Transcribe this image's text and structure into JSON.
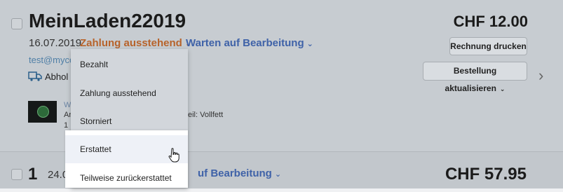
{
  "order1": {
    "title": "MeinLaden22019",
    "date": "16.07.2019",
    "payment_status": "Zahlung ausstehend",
    "fulfillment_status": "Warten auf Bearbeitung",
    "email": "test@myco",
    "pickup": "Abhol",
    "price": "CHF 12.00",
    "print_button": "Rechnung drucken",
    "update_button": "Bestellung aktualisieren",
    "product": {
      "name_link": "W",
      "variant_prefix": "Ar",
      "variant_suffix": "eil: Vollfett",
      "qty": "1"
    }
  },
  "order2": {
    "number": "1",
    "date": "24.06",
    "fulfillment_status": "uf Bearbeitung",
    "price": "CHF 57.95"
  },
  "payment_dropdown": {
    "items": [
      "Bezahlt",
      "Zahlung ausstehend",
      "Storniert",
      "Erstattet",
      "Teilweise zurückerstattet"
    ],
    "hovered_item": "Erstattet"
  },
  "colors": {
    "payment_pending": "#b7632b",
    "link_blue": "#3f62a8",
    "overlay": "#c7ccd1"
  }
}
